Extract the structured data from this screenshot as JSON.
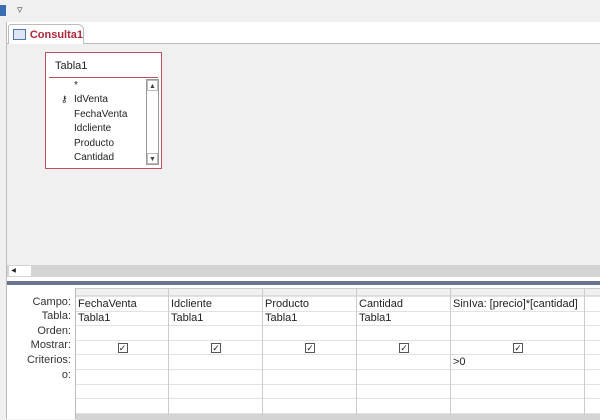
{
  "toolbar": {
    "customize_icon": "▿"
  },
  "tab": {
    "label": "Consulta1"
  },
  "table_box": {
    "title": "Tabla1",
    "fields": [
      "*",
      "IdVenta",
      "FechaVenta",
      "Idcliente",
      "Producto",
      "Cantidad"
    ],
    "primary_key": "IdVenta"
  },
  "grid": {
    "row_labels": [
      "Campo:",
      "Tabla:",
      "Orden:",
      "Mostrar:",
      "Criterios:",
      "o:"
    ],
    "columns": [
      {
        "campo": "FechaVenta",
        "tabla": "Tabla1",
        "orden": "",
        "mostrar": true,
        "criterios": ""
      },
      {
        "campo": "Idcliente",
        "tabla": "Tabla1",
        "orden": "",
        "mostrar": true,
        "criterios": ""
      },
      {
        "campo": "Producto",
        "tabla": "Tabla1",
        "orden": "",
        "mostrar": true,
        "criterios": ""
      },
      {
        "campo": "Cantidad",
        "tabla": "Tabla1",
        "orden": "",
        "mostrar": true,
        "criterios": ""
      },
      {
        "campo": "SinIva: [precio]*[cantidad]",
        "tabla": "",
        "orden": "",
        "mostrar": true,
        "criterios": ">0"
      }
    ]
  }
}
